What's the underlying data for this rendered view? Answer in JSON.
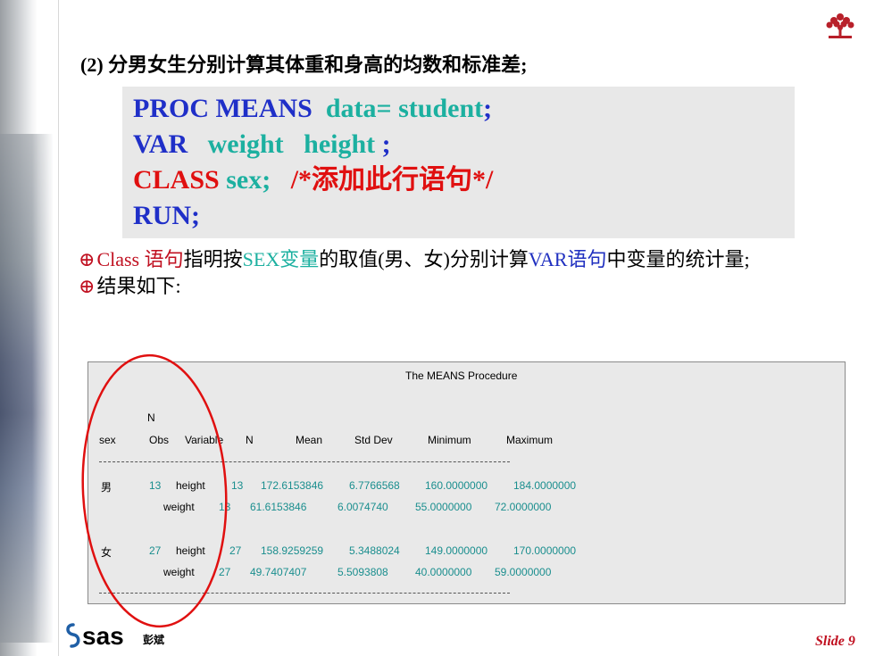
{
  "heading": "(2) 分男女生分别计算其体重和身高的均数和标准差;",
  "code": {
    "line1": {
      "kw": "PROC MEANS",
      "arg": "data= student",
      "end": ";"
    },
    "line2": {
      "kw": "VAR",
      "arg": "weight   height",
      "end": " ;"
    },
    "line3": {
      "kw": "CLASS",
      "arg": "sex;",
      "comment": "/*添加此行语句*/"
    },
    "line4": {
      "kw": "RUN;"
    }
  },
  "bullets": [
    {
      "symbol": "⊕",
      "p1": "Class 语句",
      "p2": "指明按",
      "p3": "SEX变量",
      "p4": "的取值(男、女)分别计算",
      "p5": "VAR语句",
      "p6": "中变量的统计量;"
    },
    {
      "symbol": "⊕",
      "text": "结果如下:"
    }
  ],
  "output": {
    "title": "The MEANS Procedure",
    "header_n": "N",
    "headers": [
      "sex",
      "Obs",
      "Variable",
      "N",
      "Mean",
      "Std Dev",
      "Minimum",
      "Maximum"
    ],
    "rows": [
      {
        "sex": "男",
        "obs": "13",
        "var": "height",
        "n": "13",
        "mean": "172.6153846",
        "std": "6.7766568",
        "min": "160.0000000",
        "max": "184.0000000"
      },
      {
        "sex": "",
        "obs": "",
        "var": "weight",
        "n": "13",
        "mean": "61.6153846",
        "std": "6.0074740",
        "min": "55.0000000",
        "max": "72.0000000"
      },
      {
        "sex": "女",
        "obs": "27",
        "var": "height",
        "n": "27",
        "mean": "158.9259259",
        "std": "5.3488024",
        "min": "149.0000000",
        "max": "170.0000000"
      },
      {
        "sex": "",
        "obs": "",
        "var": "weight",
        "n": "27",
        "mean": "49.7407407",
        "std": "5.5093808",
        "min": "40.0000000",
        "max": "59.0000000"
      }
    ]
  },
  "footer": {
    "logo_text": "sas",
    "author": "彭斌",
    "slide_label": "Slide 9"
  },
  "colors": {
    "keyword": "#1f2fc8",
    "argument": "#1cb0a0",
    "class_line": "#e01010",
    "ellipse": "#e01010"
  }
}
